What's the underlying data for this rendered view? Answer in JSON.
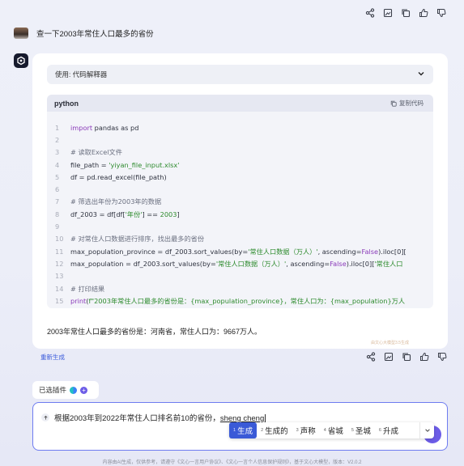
{
  "top_actions": [
    "share-icon",
    "image-icon",
    "copy-icon",
    "thumb-up-icon",
    "thumb-down-icon"
  ],
  "user_message": "查一下2003年常住人口最多的省份",
  "tool_panel": {
    "label": "使用: 代码解释器"
  },
  "code_block": {
    "language": "python",
    "copy_label": "复制代码",
    "lines": [
      "1",
      "2",
      "3",
      "4",
      "5",
      "6",
      "7",
      "8",
      "9",
      "10",
      "11",
      "12",
      "13",
      "14",
      "15"
    ],
    "code": {
      "l1_kw": "import",
      "l1_rest": " pandas as pd",
      "l3": "# 读取Excel文件",
      "l4_a": "file_path = ",
      "l4_str": "'yiyan_file_input.xlsx'",
      "l5": "df = pd.read_excel(file_path)",
      "l7": "# 筛选出年份为2003年的数据",
      "l8_a": "df_2003 = df[df[",
      "l8_str": "'年份'",
      "l8_b": "] == ",
      "l8_num": "2003",
      "l8_c": "]",
      "l10": "# 对常住人口数据进行排序，找出最多的省份",
      "l11_a": "max_population_province = df_2003.sort_values(by=",
      "l11_str": "'常住人口数据（万人）'",
      "l11_b": ", ascending=",
      "l11_kw": "False",
      "l11_c": ").iloc[0][",
      "l12_a": "max_population = df_2003.sort_values(by=",
      "l12_str": "'常住人口数据（万人）'",
      "l12_b": ", ascending=",
      "l12_kw": "False",
      "l12_c": ").iloc[0][",
      "l12_str2": "'常住人口",
      "l14": "# 打印结果",
      "l15_kw": "print",
      "l15_a": "(",
      "l15_str": "f\"2003年常住人口最多的省份是：{max_population_province}，常住人口为：{max_population}万人"
    }
  },
  "answer": "2003年常住人口最多的省份是：河南省，常住人口为：9667万人。",
  "watermark": "由文心大模型3.5生成",
  "regenerate_label": "重新生成",
  "bottom_actions": [
    "share-icon",
    "image-icon",
    "copy-icon",
    "thumb-up-icon",
    "thumb-down-icon"
  ],
  "plugins_label": "已选插件",
  "input": {
    "text": "根据2003年到2022年常住人口排名前10的省份，",
    "pinyin": "sheng cheng"
  },
  "ime_candidates": [
    {
      "n": "1",
      "text": "生成"
    },
    {
      "n": "2",
      "text": "生成的"
    },
    {
      "n": "3",
      "text": "声称"
    },
    {
      "n": "4",
      "text": "省城"
    },
    {
      "n": "5",
      "text": "圣城"
    },
    {
      "n": "6",
      "text": "升成"
    }
  ],
  "footer": "内容由AI生成，仅供参考，请遵守《文心一言用户协议》、《文心一言个人信息保护规则》，基于文心大模型，版本：V2.0.2",
  "colors": {
    "accent": "#3a5ad7",
    "input_border": "#6e7cf0",
    "send": "#6c5ce7"
  }
}
